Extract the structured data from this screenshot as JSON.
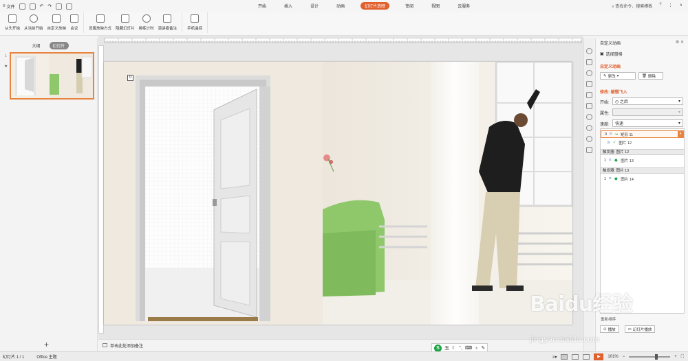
{
  "titlebar": {
    "file_menu": "文件",
    "tabs": [
      "开始",
      "插入",
      "设计",
      "动画",
      "幻灯片放映",
      "审阅",
      "视图",
      "云服务"
    ],
    "active_tab": "幻灯片放映",
    "search_placeholder": "查找命令、搜索模板",
    "help": "?"
  },
  "ribbon": {
    "buttons": [
      "从头开始",
      "从当前开始",
      "自定义放映",
      "会议",
      "设置放映方式",
      "隐藏幻灯片",
      "排练计时",
      "演讲者备注",
      "手机遥控"
    ]
  },
  "left_pane": {
    "tab_outline": "大纲",
    "tab_slides": "幻灯片",
    "slide_number": "1",
    "star": "★",
    "add_slide": "+"
  },
  "slide": {
    "badge": "0"
  },
  "notes": {
    "placeholder": "单击此处添加备注"
  },
  "ime": {
    "logo": "S",
    "mode": "五"
  },
  "right_pane": {
    "title": "自定义动画",
    "controls": "⚙ ✕",
    "selection_pane": "选择窗格",
    "section_custom": "自定义动画",
    "change_button": "更改",
    "delete_button": "删除",
    "modify_label": "修改: 缓慢飞入",
    "start_label": "开始:",
    "start_value": "之后",
    "property_label": "属性:",
    "speed_label": "速度:",
    "speed_value": "快速",
    "items": [
      {
        "index": "0",
        "name": "矩形 11"
      },
      {
        "index": "",
        "name": "图片 12"
      }
    ],
    "trigger1": "触发器: 图片 12",
    "trigger1_item": {
      "index": "1",
      "name": "图片 13"
    },
    "trigger2": "触发器: 图片 13",
    "trigger2_item": {
      "index": "1",
      "name": "图片 14"
    },
    "reorder": "重新排序",
    "play_button": "播放",
    "slideshow_button": "幻灯片播放"
  },
  "statusbar": {
    "slide_info": "幻灯片 1 / 1",
    "theme": "Office 主题",
    "zoom": "101%",
    "zoom_minus": "−",
    "zoom_plus": "+"
  },
  "watermark": {
    "main": "Baidu经验",
    "sub": "jingyan.baidu.com"
  },
  "colors": {
    "accent": "#e0602e",
    "selection": "#e8843f",
    "sofa_green": "#8ec86a"
  }
}
